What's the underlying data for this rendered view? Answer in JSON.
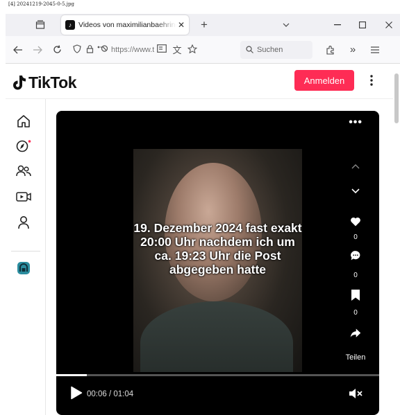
{
  "caption": "[4] 20241219-2045-0-5.jpg",
  "browser": {
    "tab_title": "Videos von maximilianbaehring",
    "url_text": "https://www.tik",
    "search_placeholder": "Suchen"
  },
  "header": {
    "logo_text": "TikTok",
    "login_label": "Anmelden",
    "brand_color": "#fe2c55"
  },
  "sidebar": {
    "items": [
      {
        "name": "home-icon"
      },
      {
        "name": "explore-icon"
      },
      {
        "name": "following-icon"
      },
      {
        "name": "live-icon"
      },
      {
        "name": "profile-icon"
      },
      {
        "name": "app-badge-icon"
      }
    ]
  },
  "video": {
    "overlay_text": "19. Dezember 2024 fast exakt 20:00 Uhr nachdem ich um ca. 19:23 Uhr die Post abgegeben hatte",
    "like_count": "0",
    "comment_count": "0",
    "save_count": "0",
    "share_label": "Teilen",
    "time_display": "00:06 / 01:04",
    "progress": 0.094
  }
}
